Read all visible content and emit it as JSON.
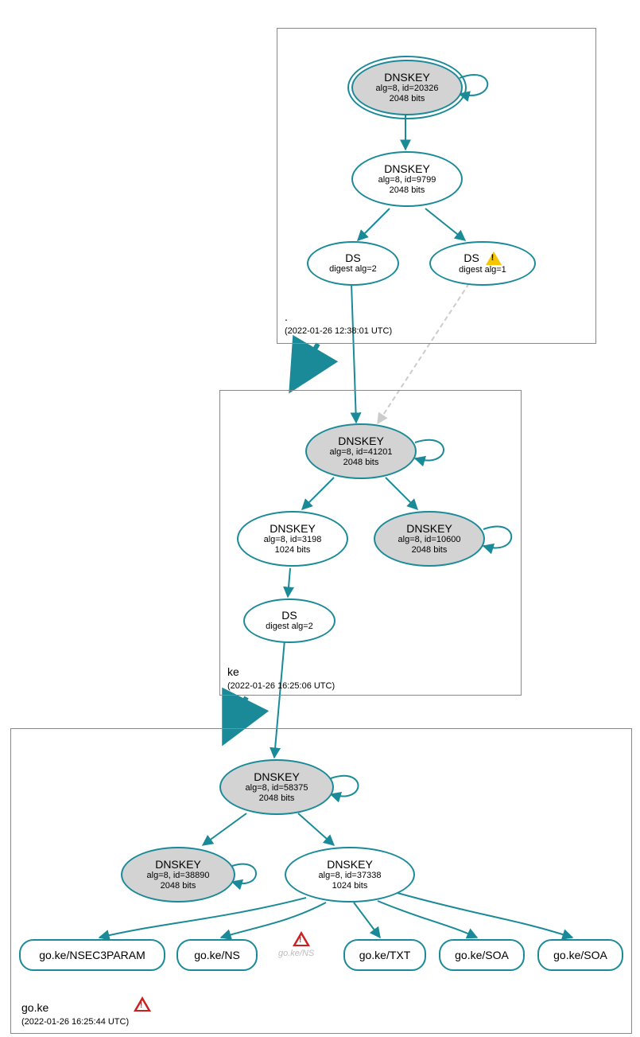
{
  "zones": {
    "root": {
      "label": ".",
      "timestamp": "(2022-01-26 12:38:01 UTC)",
      "nodes": {
        "k20326": {
          "title": "DNSKEY",
          "sub1": "alg=8, id=20326",
          "sub2": "2048 bits"
        },
        "k9799": {
          "title": "DNSKEY",
          "sub1": "alg=8, id=9799",
          "sub2": "2048 bits"
        },
        "ds2": {
          "title": "DS",
          "sub1": "digest alg=2"
        },
        "ds1": {
          "title": "DS",
          "sub1": "digest alg=1"
        }
      }
    },
    "ke": {
      "label": "ke",
      "timestamp": "(2022-01-26 16:25:06 UTC)",
      "nodes": {
        "k41201": {
          "title": "DNSKEY",
          "sub1": "alg=8, id=41201",
          "sub2": "2048 bits"
        },
        "k3198": {
          "title": "DNSKEY",
          "sub1": "alg=8, id=3198",
          "sub2": "1024 bits"
        },
        "k10600": {
          "title": "DNSKEY",
          "sub1": "alg=8, id=10600",
          "sub2": "2048 bits"
        },
        "ds2": {
          "title": "DS",
          "sub1": "digest alg=2"
        }
      }
    },
    "go_ke": {
      "label": "go.ke",
      "timestamp": "(2022-01-26 16:25:44 UTC)",
      "nodes": {
        "k58375": {
          "title": "DNSKEY",
          "sub1": "alg=8, id=58375",
          "sub2": "2048 bits"
        },
        "k38890": {
          "title": "DNSKEY",
          "sub1": "alg=8, id=38890",
          "sub2": "2048 bits"
        },
        "k37338": {
          "title": "DNSKEY",
          "sub1": "alg=8, id=37338",
          "sub2": "1024 bits"
        }
      },
      "leaves": {
        "nsec3": "go.ke/NSEC3PARAM",
        "ns": "go.ke/NS",
        "nsmuted": "go.ke/NS",
        "txt": "go.ke/TXT",
        "soa1": "go.ke/SOA",
        "soa2": "go.ke/SOA"
      }
    }
  }
}
